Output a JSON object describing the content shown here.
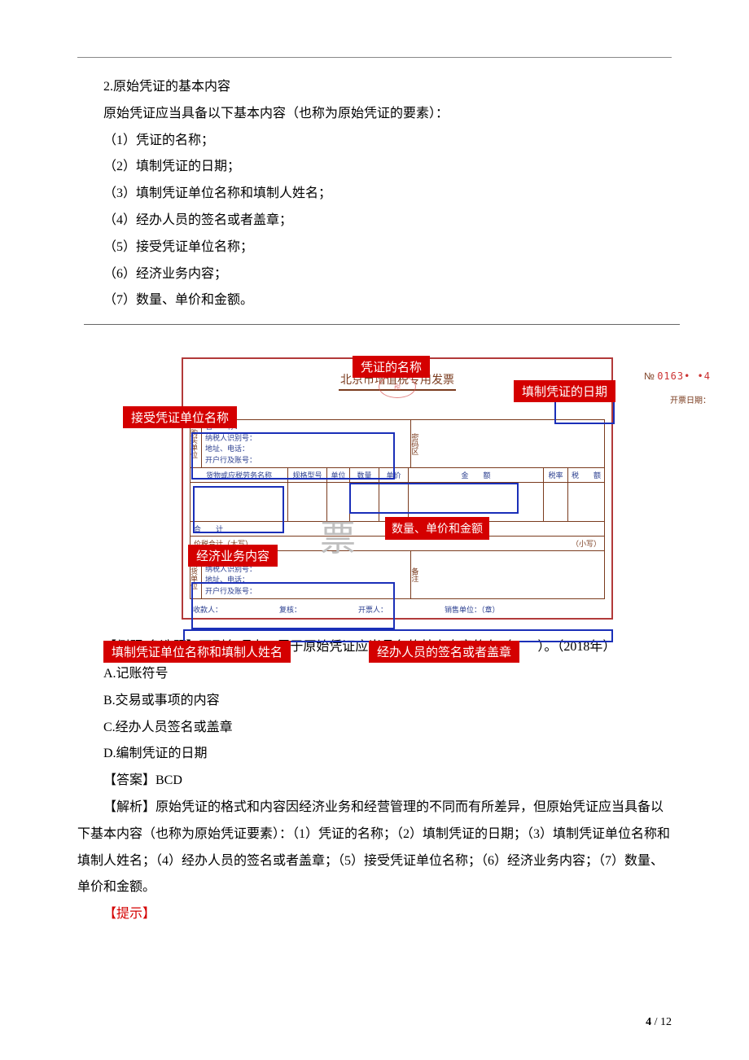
{
  "section": {
    "heading": "2.原始凭证的基本内容",
    "intro": "原始凭证应当具备以下基本内容（也称为原始凭证的要素）：",
    "items": [
      "（1）凭证的名称；",
      "（2）填制凭证的日期；",
      "（3）填制凭证单位名称和填制人姓名；",
      "（4）经办人员的签名或者盖章；",
      "（5）接受凭证单位名称；",
      "（6）经济业务内容；",
      "（7）数量、单价和金额。"
    ]
  },
  "diagram": {
    "tags": {
      "title": "凭证的名称",
      "date": "填制凭证的日期",
      "receiver": "接受凭证单位名称",
      "qty": "数量、单价和金额",
      "content": "经济业务内容",
      "filler": "填制凭证单位名称和填制人姓名",
      "handler": "经办人员的签名或者盖章"
    },
    "invoice": {
      "title": "北京市增值税专用发票",
      "no_label": "№",
      "no_value": "0163• •4",
      "date_label": "开票日期：",
      "buyer_side": "购买单位",
      "code_side": "密码区",
      "seller_side": "销货单位",
      "note_side": "备注",
      "fields": {
        "name": "名　　称：",
        "taxid": "纳税人识别号：",
        "addr": "地址、电话：",
        "bank": "开户行及账号："
      },
      "thead": {
        "name": "货物或应税劳务名称",
        "spec": "规格型号",
        "unit": "单位",
        "qty": "数量",
        "price": "单价",
        "amt": "金　　额",
        "rate": "税率",
        "tax": "税　　额"
      },
      "piao": "票",
      "total_label": "合　　计",
      "sum_label_l": "价税合计（大写）",
      "sum_label_r": "（小写）",
      "foot": {
        "payee": "收款人：",
        "checker": "复核：",
        "drawer": "开票人：",
        "seller": "销售单位：（章）"
      }
    }
  },
  "question": {
    "stem_prefix": "【例题·多选题】下列各项中，属于原始凭证应当具备的基本内容的有（　　）。（2018年）",
    "options": {
      "A": "A.记账符号",
      "B": "B.交易或事项的内容",
      "C": "C.经办人员签名或盖章",
      "D": "D.编制凭证的日期"
    },
    "answer_label": "【答案】BCD",
    "explain": "【解析】原始凭证的格式和内容因经济业务和经营管理的不同而有所差异，但原始凭证应当具备以下基本内容（也称为原始凭证要素）：（1）凭证的名称；（2）填制凭证的日期；（3）填制凭证单位名称和填制人姓名；（4）经办人员的签名或者盖章；（5）接受凭证单位名称；（6）经济业务内容；（7）数量、单价和金额。",
    "hint_label": "【提示】"
  },
  "pagination": {
    "current": "4",
    "sep": " / ",
    "total": "12"
  }
}
